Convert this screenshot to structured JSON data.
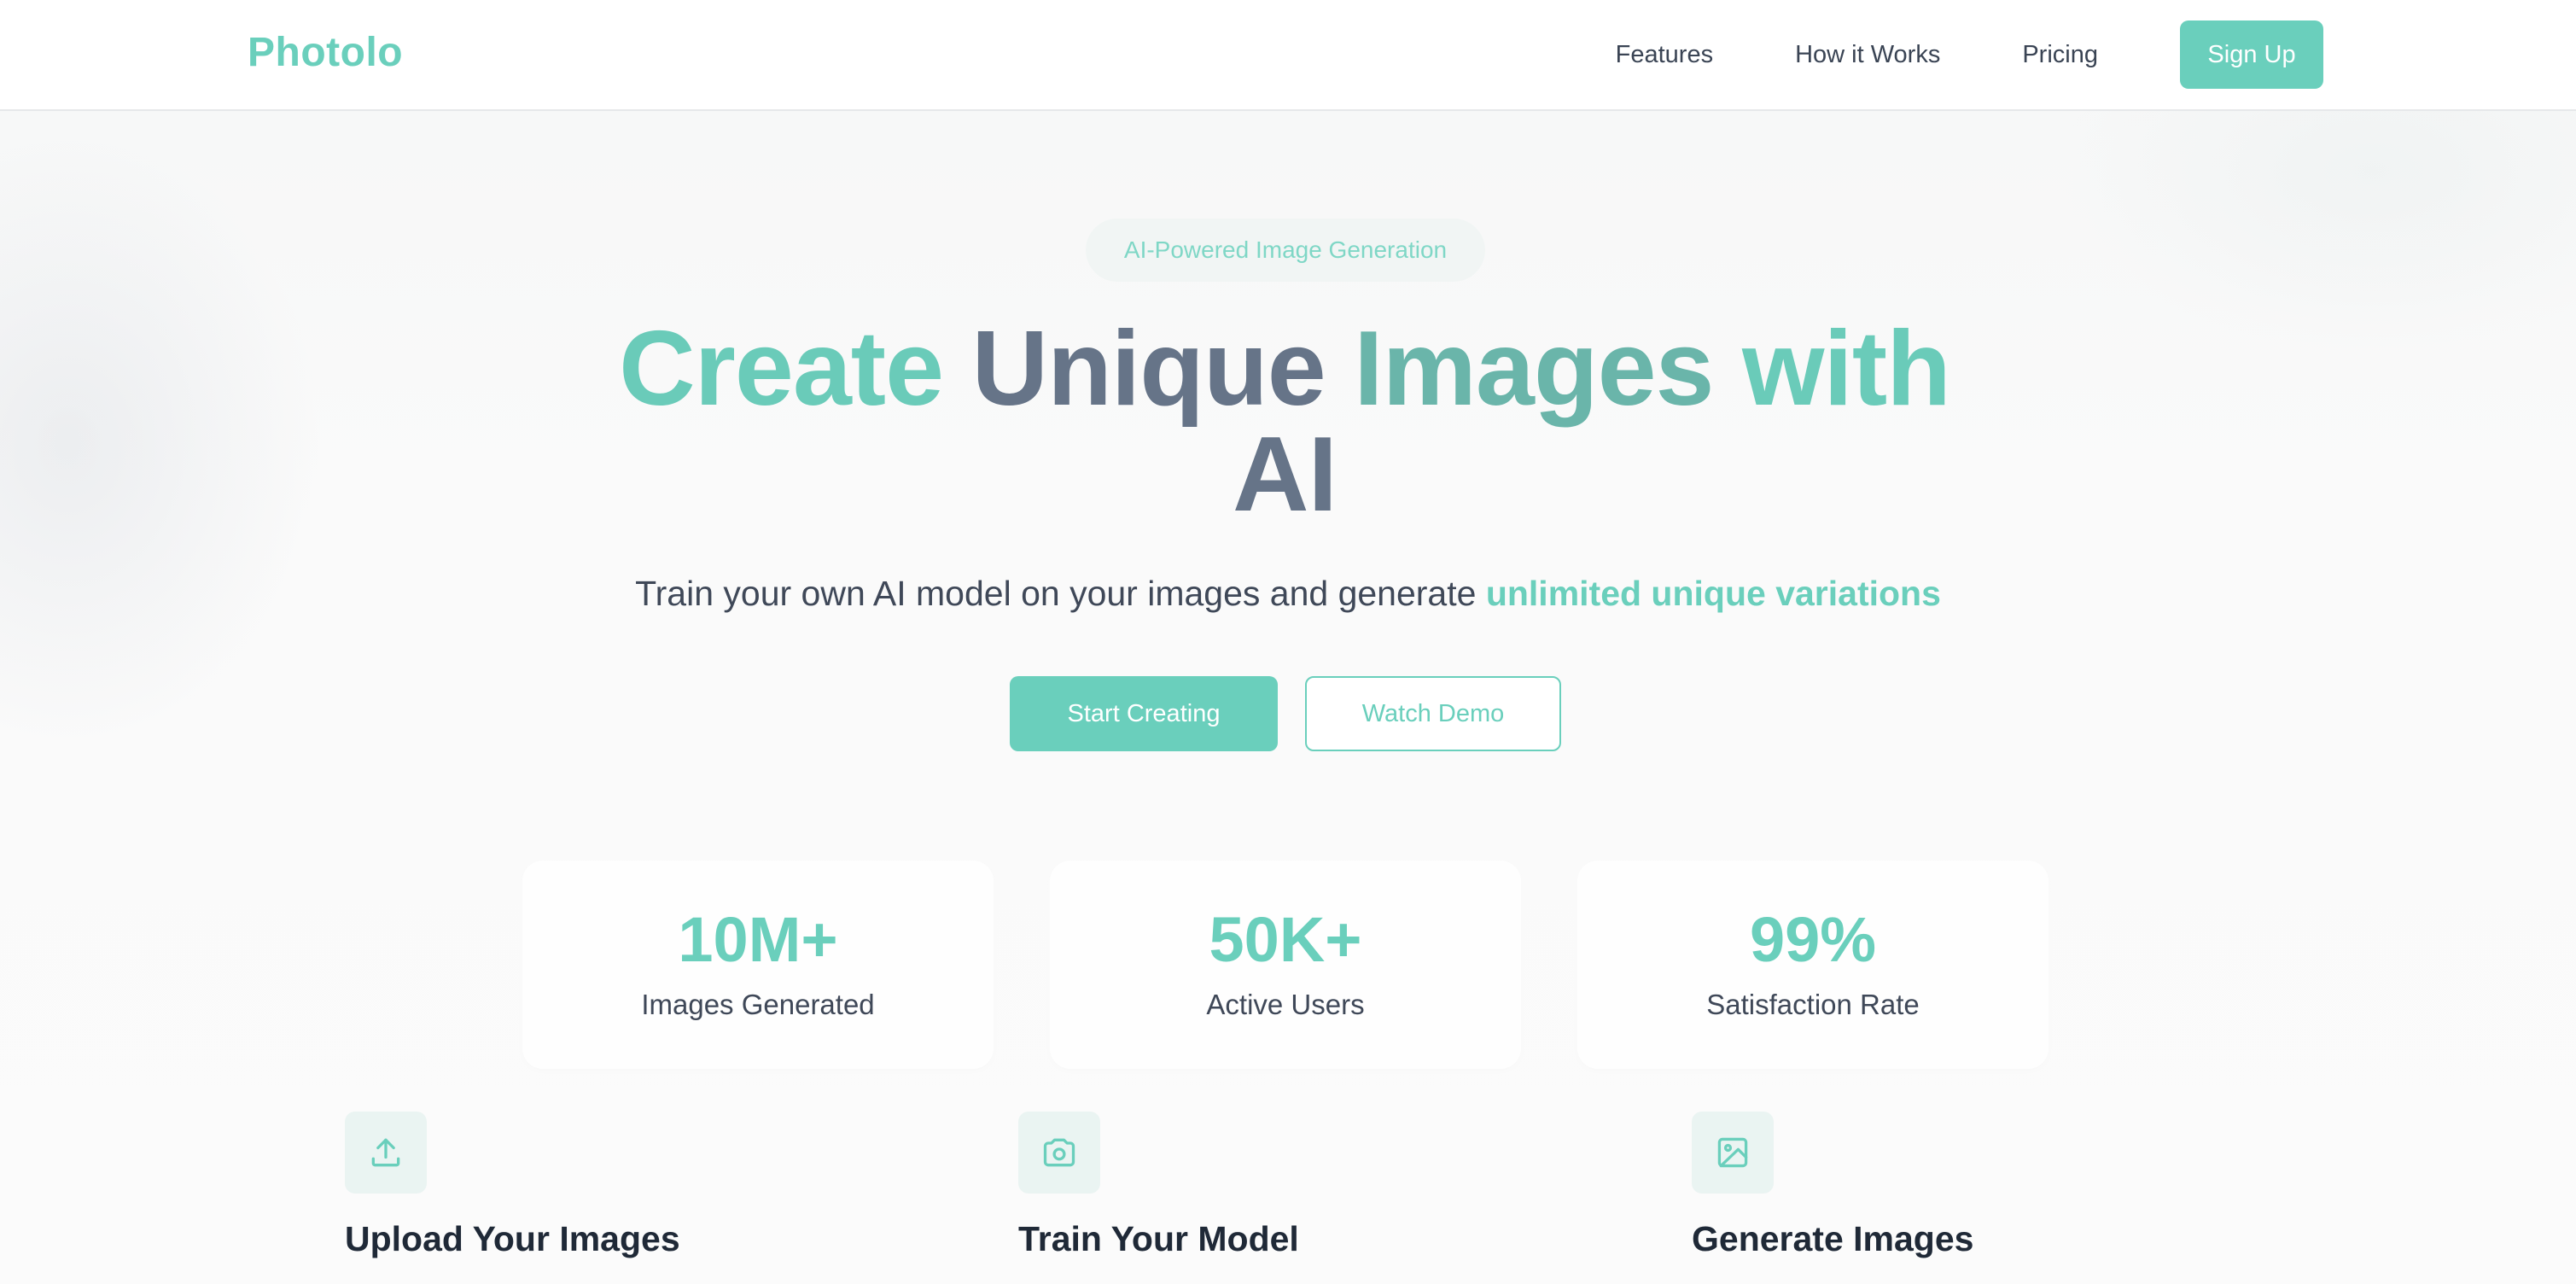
{
  "brand": {
    "name": "Photolo",
    "accent_color": "#6acfbc",
    "dark_gradient_color": "#667488"
  },
  "nav": {
    "links": [
      "Features",
      "How it Works",
      "Pricing"
    ],
    "signup_label": "Sign Up"
  },
  "hero": {
    "badge": "AI-Powered Image Generation",
    "title_parts": [
      "Create",
      "Unique",
      "Images",
      "with",
      "AI"
    ],
    "subtitle_text": "Train your own AI model on your images and generate ",
    "subtitle_highlight": "unlimited unique variations",
    "primary_button": "Start Creating",
    "secondary_button": "Watch Demo"
  },
  "stats": [
    {
      "value": "10M+",
      "label": "Images Generated"
    },
    {
      "value": "50K+",
      "label": "Active Users"
    },
    {
      "value": "99%",
      "label": "Satisfaction Rate"
    }
  ],
  "features": [
    {
      "icon": "upload-icon",
      "title": "Upload Your Images"
    },
    {
      "icon": "camera-icon",
      "title": "Train Your Model"
    },
    {
      "icon": "image-icon",
      "title": "Generate Images"
    }
  ]
}
